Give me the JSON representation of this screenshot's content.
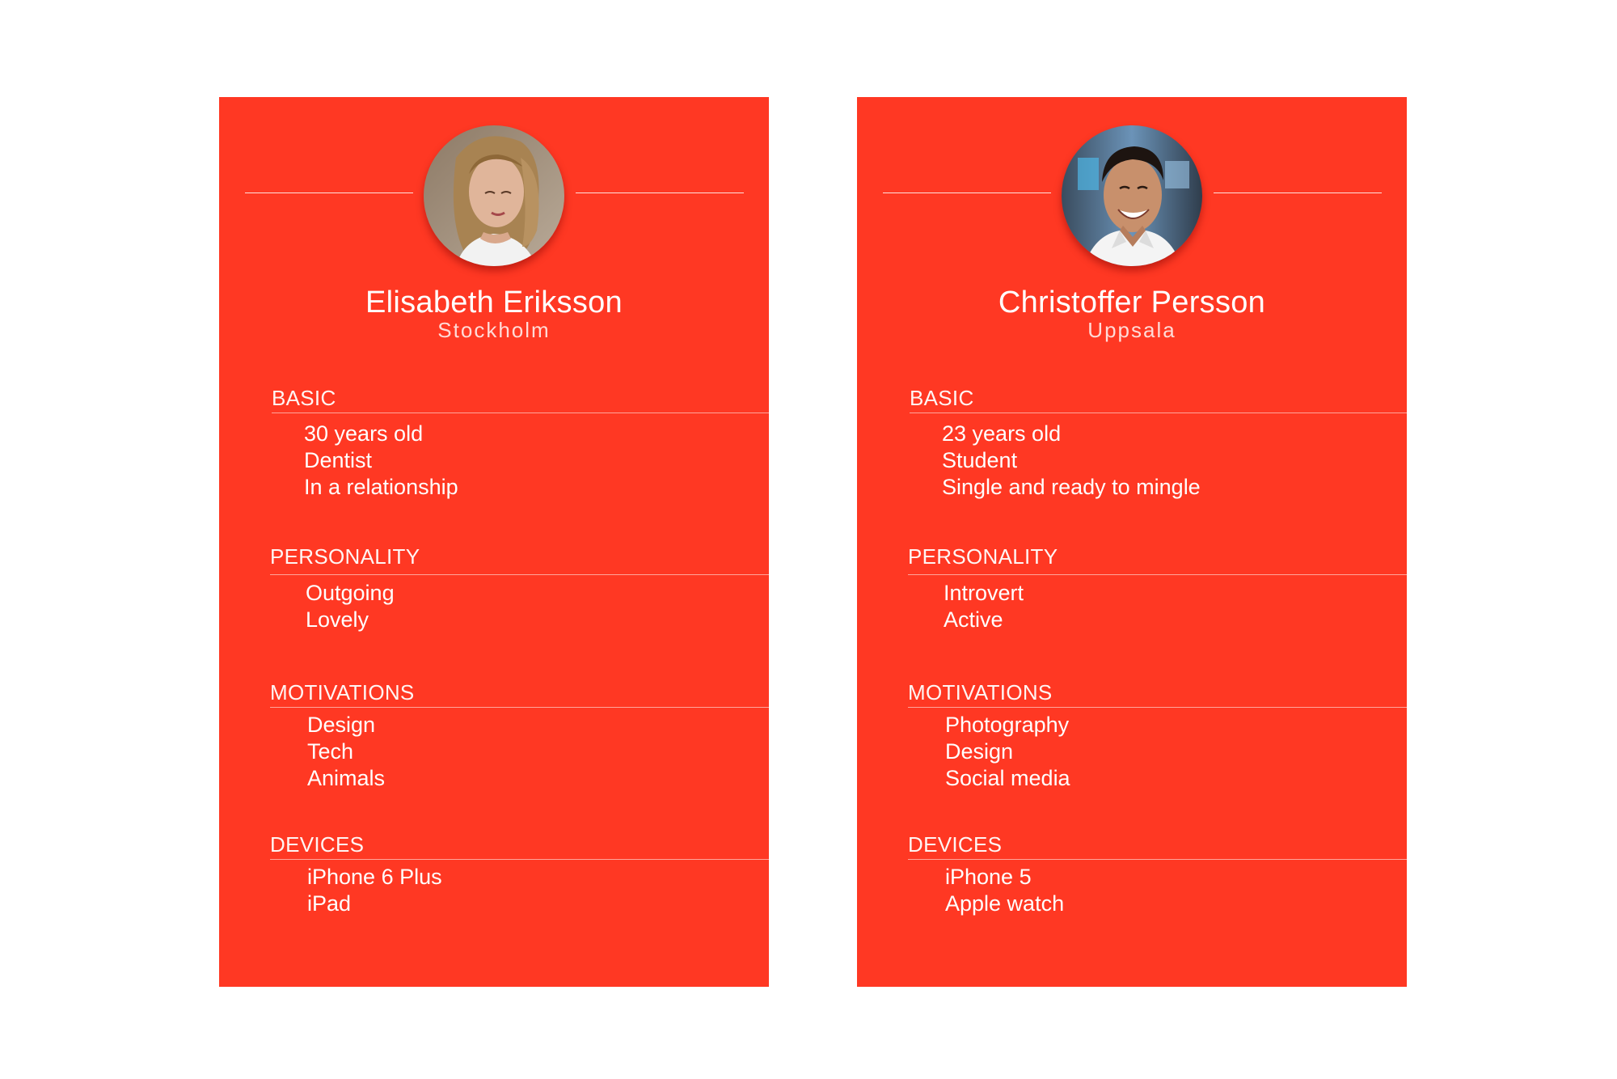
{
  "colors": {
    "card_background": "#ff3823",
    "text": "#ffffff",
    "page_background": "#ffffff"
  },
  "personas": [
    {
      "name": "Elisabeth Eriksson",
      "city": "Stockholm",
      "avatar_icon": "woman-portrait-photo",
      "sections": {
        "basic": {
          "heading": "BASIC",
          "items": [
            "30 years old",
            "Dentist",
            "In a relationship"
          ]
        },
        "personality": {
          "heading": "PERSONALITY",
          "items": [
            "Outgoing",
            "Lovely"
          ]
        },
        "motivations": {
          "heading": "MOTIVATIONS",
          "items": [
            "Design",
            "Tech",
            "Animals"
          ]
        },
        "devices": {
          "heading": "DEVICES",
          "items": [
            "iPhone 6 Plus",
            "iPad"
          ]
        }
      }
    },
    {
      "name": "Christoffer Persson",
      "city": "Uppsala",
      "avatar_icon": "man-portrait-photo",
      "sections": {
        "basic": {
          "heading": "BASIC",
          "items": [
            "23 years old",
            "Student",
            "Single and ready to mingle"
          ]
        },
        "personality": {
          "heading": "PERSONALITY",
          "items": [
            "Introvert",
            "Active"
          ]
        },
        "motivations": {
          "heading": "MOTIVATIONS",
          "items": [
            "Photography",
            "Design",
            "Social media"
          ]
        },
        "devices": {
          "heading": "DEVICES",
          "items": [
            "iPhone 5",
            "Apple watch"
          ]
        }
      }
    }
  ]
}
